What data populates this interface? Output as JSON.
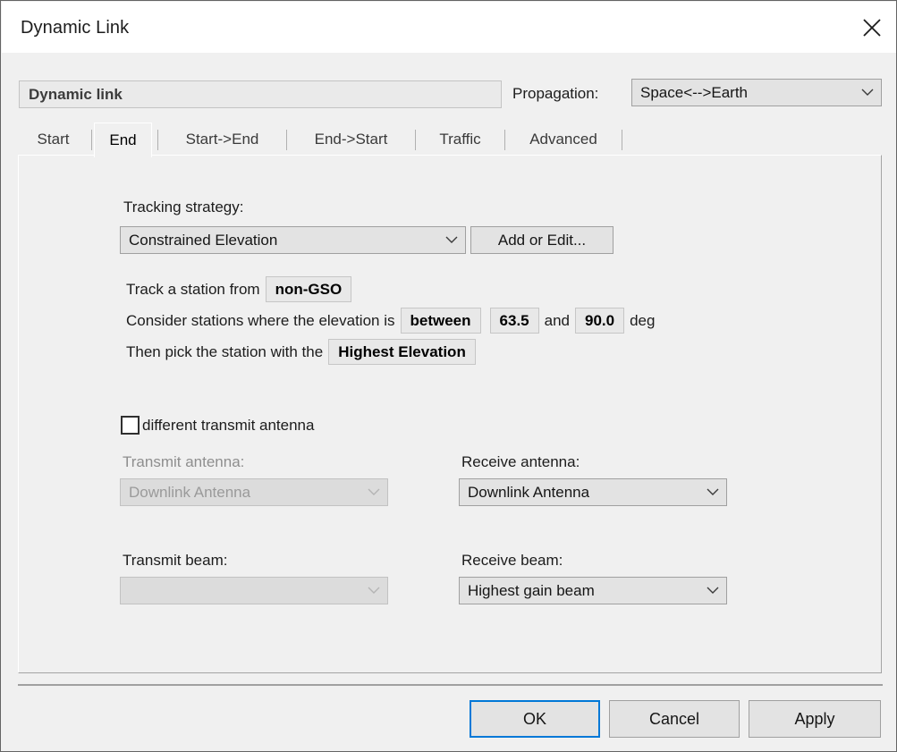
{
  "window": {
    "title": "Dynamic Link",
    "close_icon": "close-icon"
  },
  "header": {
    "link_name": "Dynamic link",
    "propagation_label": "Propagation:",
    "propagation_value": "Space<-->Earth"
  },
  "tabs": [
    {
      "label": "Start",
      "active": false
    },
    {
      "label": "End",
      "active": true
    },
    {
      "label": "Start->End",
      "active": false
    },
    {
      "label": "End->Start",
      "active": false
    },
    {
      "label": "Traffic",
      "active": false
    },
    {
      "label": "Advanced",
      "active": false
    }
  ],
  "content": {
    "tracking_strategy_label": "Tracking strategy:",
    "tracking_strategy_value": "Constrained Elevation",
    "add_or_edit_label": "Add or Edit...",
    "sentence1": {
      "prefix": "Track a station from",
      "chip": "non-GSO"
    },
    "sentence2": {
      "prefix": "Consider stations where the elevation is",
      "chip_condition": "between",
      "chip_min": "63.5",
      "mid": "and",
      "chip_max": "90.0",
      "suffix": "deg"
    },
    "sentence3": {
      "prefix": "Then pick the station with the",
      "chip": "Highest Elevation"
    },
    "different_tx_antenna_label": "different transmit antenna",
    "different_tx_antenna_checked": false,
    "transmit_antenna_label": "Transmit antenna:",
    "transmit_antenna_value": "Downlink Antenna",
    "receive_antenna_label": "Receive antenna:",
    "receive_antenna_value": "Downlink Antenna",
    "transmit_beam_label": "Transmit beam:",
    "transmit_beam_value": "",
    "receive_beam_label": "Receive beam:",
    "receive_beam_value": "Highest gain beam"
  },
  "footer": {
    "ok_label": "OK",
    "cancel_label": "Cancel",
    "apply_label": "Apply"
  },
  "colors": {
    "focus_blue": "#0078d7",
    "window_bg": "#f0f0f0",
    "control_bg": "#e3e3e3",
    "chip_bg": "#e8e8e8"
  }
}
